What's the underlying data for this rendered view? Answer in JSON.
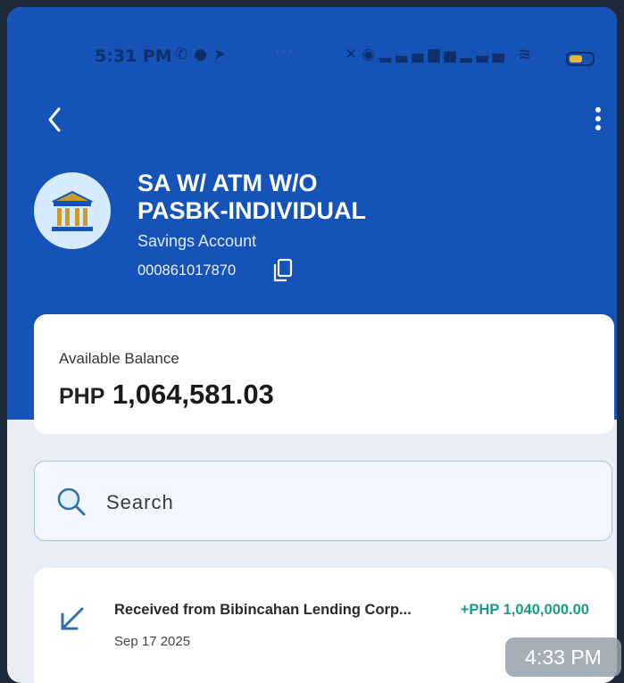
{
  "status_bar": {
    "time": "5:31 PM",
    "left_icons": [
      "whatsapp-icon",
      "chat-icon",
      "telegram-icon"
    ],
    "dots": "···",
    "right_icons": [
      "mute-icon",
      "location-icon",
      "signal-icon",
      "volte-icon",
      "signal-icon",
      "wifi-icon",
      "battery-icon"
    ]
  },
  "toolbar": {
    "back_icon": "chevron-left-icon",
    "menu_icon": "kebab-menu-icon"
  },
  "account": {
    "name": "SA W/ ATM W/O\nPASBK-INDIVIDUAL",
    "type": "Savings Account",
    "number": "000861017870",
    "icon": "bank-icon"
  },
  "balance": {
    "label": "Available Balance",
    "currency": "PHP",
    "amount": "1,064,581.03"
  },
  "search": {
    "placeholder": "Search"
  },
  "transactions": [
    {
      "description": "Received from Bibincahan Lending Corp...",
      "amount": "+PHP 1,040,000.00",
      "date": "Sep 17 2025",
      "icon": "incoming-arrow-icon"
    }
  ],
  "overlay_time": "4:33 PM",
  "colors": {
    "header_blue": "#1553b8",
    "credit_green": "#1b9c85",
    "background": "#e9eef6"
  }
}
